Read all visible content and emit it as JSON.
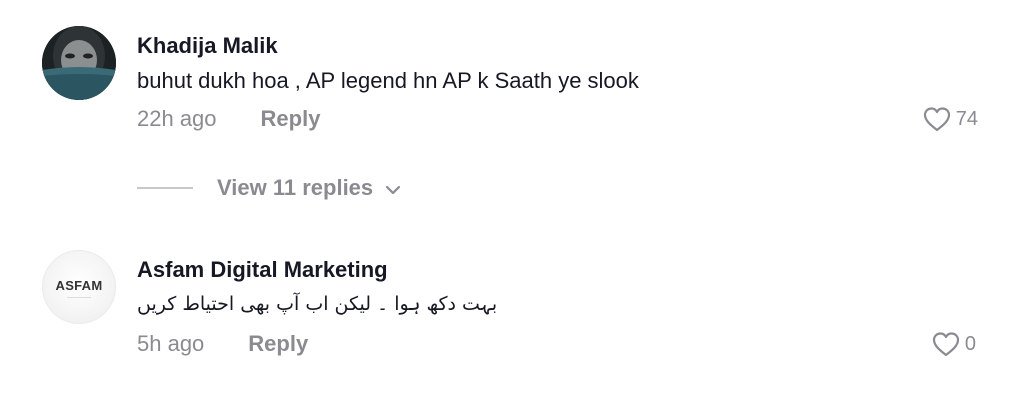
{
  "comments": [
    {
      "username": "Khadija Malik",
      "text": "buhut dukh hoa , AP legend hn AP k Saath ye slook",
      "time": "22h ago",
      "reply_label": "Reply",
      "likes": "74"
    },
    {
      "username": "Asfam Digital Marketing",
      "avatar_logo": "ASFAM",
      "text": "بہت دکھ ہوا ۔ لیکن اب آپ بھی احتیاط کریں",
      "time": "5h ago",
      "reply_label": "Reply",
      "likes": "0"
    }
  ],
  "view_replies": {
    "label": "View 11 replies"
  },
  "icons": {
    "like": "heart-outline-icon",
    "expand": "chevron-down-icon"
  },
  "colors": {
    "text": "#161823",
    "muted": "#8a8b91"
  }
}
